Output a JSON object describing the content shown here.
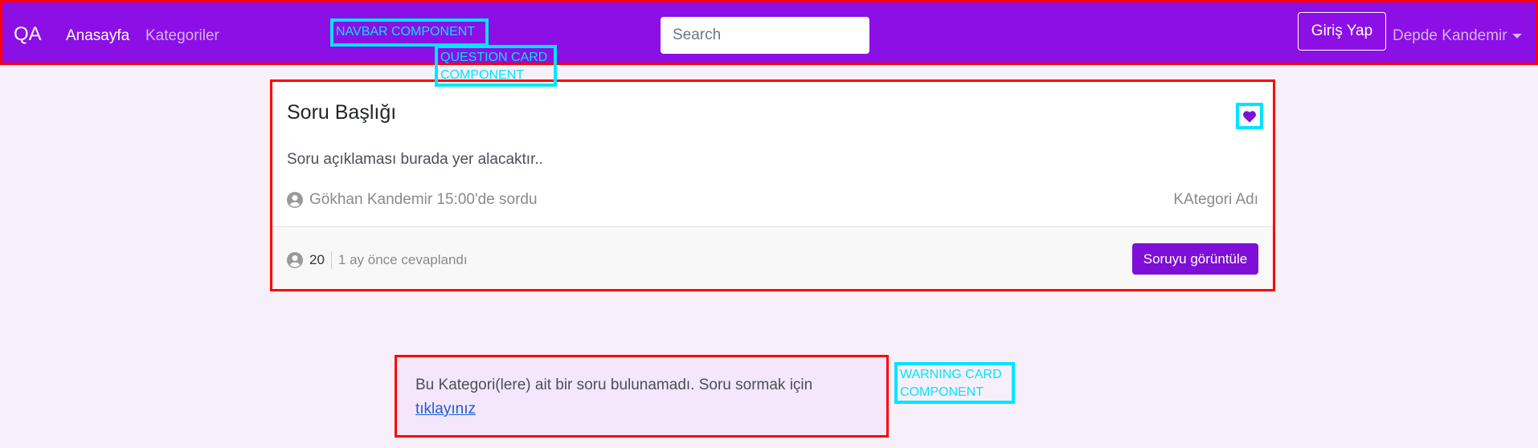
{
  "navbar": {
    "brand": "QA",
    "links": [
      "Anasayfa",
      "Kategoriler"
    ],
    "search_placeholder": "Search",
    "login_label": "Giriş Yap",
    "user_name": "Depde Kandemir",
    "annotation": "NAVBAR COMPONENT"
  },
  "question_card": {
    "title": "Soru Başlığı",
    "description": "Soru açıklaması burada yer alacaktır..",
    "author_meta": "Gökhan Kandemir 15:00'de sordu",
    "category": "KAtegori Adı",
    "answer_count": "20",
    "answered_text": "1 ay önce cevaplandı",
    "view_button": "Soruyu görüntüle",
    "annotation_line1": "QUESTION CARD",
    "annotation_line2": "COMPONENT"
  },
  "warning_card": {
    "message": "Bu Kategori(lere) ait bir soru bulunamadı. Soru sormak için",
    "link_text": "tıklayınız",
    "annotation_line1": "WARNING CARD",
    "annotation_line2": "COMPONENT"
  },
  "colors": {
    "navbar_bg": "#8c0fe6",
    "accent": "#7d0fd6",
    "annotation_red": "#ff0000",
    "annotation_cyan": "#00e5ff",
    "page_bg": "#f7f0fb",
    "warning_bg": "#f4e6fb"
  },
  "icons": {
    "favorite": "heart-icon",
    "user": "user-circle-icon",
    "dropdown": "caret-down-icon"
  }
}
